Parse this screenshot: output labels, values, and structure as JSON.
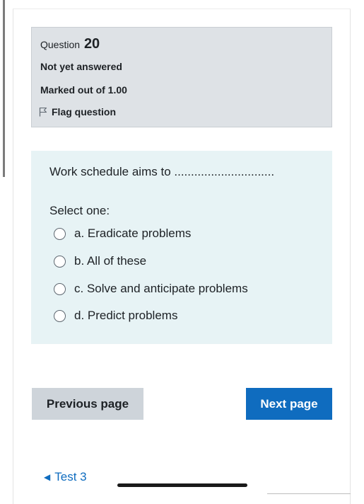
{
  "question": {
    "label": "Question",
    "number": "20",
    "state": "Not yet answered",
    "grade": "Marked out of 1.00",
    "flag_label": "Flag question"
  },
  "content": {
    "text": "Work schedule aims to ..............................",
    "prompt": "Select one:",
    "options": [
      {
        "label": "a. Eradicate problems"
      },
      {
        "label": "b. All of these"
      },
      {
        "label": "c. Solve and anticipate problems"
      },
      {
        "label": "d. Predict problems"
      }
    ]
  },
  "nav": {
    "previous_label": "Previous page",
    "next_label": "Next page",
    "back_label": "Test 3"
  },
  "colors": {
    "info_bg": "#dee2e6",
    "content_bg": "#e7f3f5",
    "primary": "#0f6cbf",
    "secondary": "#ced4da"
  }
}
